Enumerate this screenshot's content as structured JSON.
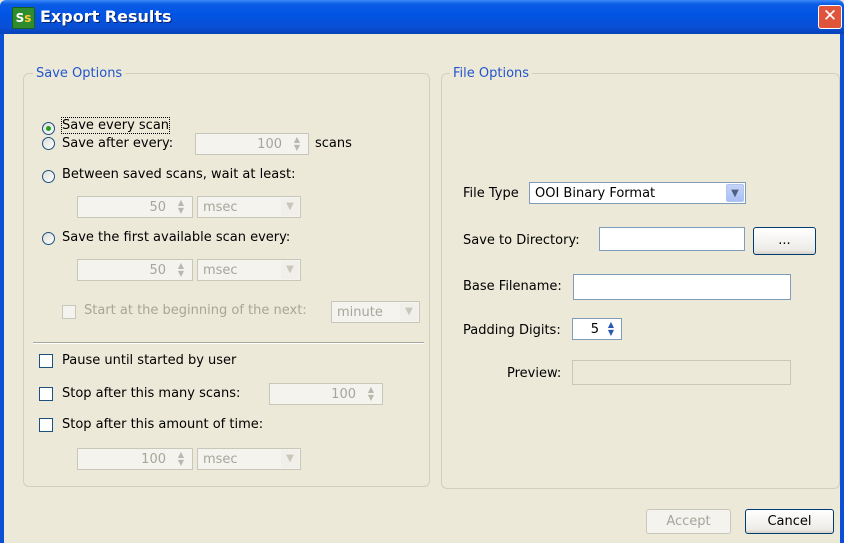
{
  "window": {
    "title": "Export Results",
    "close_glyph": "✕",
    "app_icon": "spectrasuite-icon"
  },
  "save_options": {
    "title": "Save Options",
    "save_every_scan": "Save every scan",
    "save_after_every": {
      "label": "Save after every:",
      "value": "100",
      "unit": "scans"
    },
    "between_saved": {
      "label": "Between saved scans, wait at least:",
      "value": "50",
      "unit": "msec"
    },
    "save_first_available": {
      "label": "Save the first available scan every:",
      "value": "50",
      "unit": "msec"
    },
    "start_beginning": {
      "label": "Start at the beginning of the next:",
      "value": "minute"
    },
    "pause_until_started": "Pause until started by user",
    "stop_after_scans": {
      "label": "Stop after this many scans:",
      "value": "100"
    },
    "stop_after_time": {
      "label": "Stop after this amount of time:",
      "value": "100",
      "unit": "msec"
    }
  },
  "file_options": {
    "title": "File Options",
    "file_type": {
      "label": "File Type",
      "value": "OOI Binary Format"
    },
    "save_to_directory": {
      "label": "Save to Directory:",
      "value": "",
      "browse_label": "..."
    },
    "base_filename": {
      "label": "Base Filename:",
      "value": ""
    },
    "padding_digits": {
      "label": "Padding Digits:",
      "value": "5"
    },
    "preview": {
      "label": "Preview:",
      "value": ""
    }
  },
  "buttons": {
    "accept": "Accept",
    "cancel": "Cancel"
  }
}
